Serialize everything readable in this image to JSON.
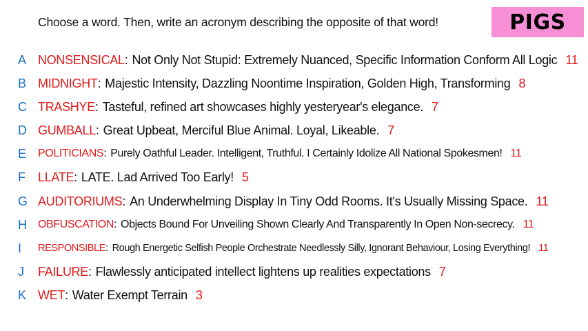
{
  "prompt": "Choose a word. Then, write an acronym describing the opposite of that word!",
  "logo": "PIGS",
  "colors": {
    "word": "#e01a1a",
    "letter": "#1a6fc9",
    "logo_bg": "#f78fd6"
  },
  "entries": [
    {
      "letter": "A",
      "word": "NONSENSICAL",
      "acronym": "Not Only Not Stupid: Extremely Nuanced, Specific Information Conform All Logic",
      "count": "11"
    },
    {
      "letter": "B",
      "word": "MIDNIGHT",
      "acronym": "Majestic Intensity, Dazzling Noontime Inspiration, Golden High, Transforming",
      "count": "8"
    },
    {
      "letter": "C",
      "word": "TRASHYE",
      "acronym": "Tasteful, refined art showcases highly yesteryear's elegance.",
      "count": "7"
    },
    {
      "letter": "D",
      "word": "GUMBALL",
      "acronym": "Great Upbeat, Merciful Blue Animal.  Loyal, Likeable.",
      "count": "7"
    },
    {
      "letter": "E",
      "word": "POLITICIANS",
      "acronym": "Purely Oathful Leader. Intelligent, Truthful. I Certainly Idolize All National Spokesmen!",
      "count": "11"
    },
    {
      "letter": "F",
      "word": "LLATE",
      "acronym": "LATE. Lad Arrived Too Early!",
      "count": "5"
    },
    {
      "letter": "G",
      "word": "AUDITORIUMS",
      "acronym": "An Underwhelming Display In Tiny Odd Rooms. It's Usually Missing Space.",
      "count": "11"
    },
    {
      "letter": "H",
      "word": "OBFUSCATION",
      "acronym": "Objects Bound For Unveiling Shown Clearly And Transparently In Open Non-secrecy.",
      "count": "11"
    },
    {
      "letter": "I",
      "word": "RESPONSIBLE",
      "acronym": "Rough Energetic Selfish People Orchestrate Needlessly Silly, Ignorant Behaviour, Losing Everything!",
      "count": "11"
    },
    {
      "letter": "J",
      "word": "FAILURE",
      "acronym": "Flawlessly anticipated intellect lightens up realities expectations",
      "count": "7"
    },
    {
      "letter": "K",
      "word": "WET",
      "acronym": "Water Exempt Terrain",
      "count": "3"
    }
  ]
}
